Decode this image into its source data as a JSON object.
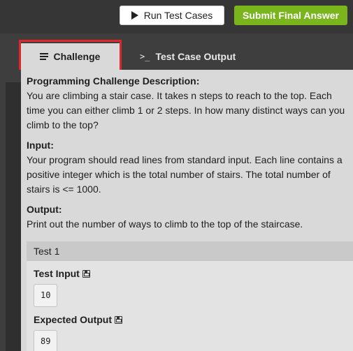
{
  "toolbar": {
    "run_label": "Run Test Cases",
    "submit_label": "Submit Final Answer"
  },
  "tabs": [
    {
      "label": "Challenge",
      "icon": "list-icon",
      "active": true
    },
    {
      "label": "Test Case Output",
      "icon": "terminal-icon",
      "active": false
    }
  ],
  "challenge": {
    "description_title": "Programming Challenge Description:",
    "description_text": "You are climbing a stair case. It takes n steps to reach to the top. Each time you can either climb 1 or 2 steps. In how many distinct ways can you climb to the top?",
    "input_title": "Input:",
    "input_text": "Your program should read lines from standard input. Each line contains a positive integer which is the total number of stairs. The total number of stairs is <= 1000.",
    "output_title": "Output:",
    "output_text": "Print out the number of ways to climb to the top of the staircase."
  },
  "test": {
    "header": "Test 1",
    "input_label": "Test Input",
    "input_value": "10",
    "expected_label": "Expected Output",
    "expected_value": "89"
  },
  "colors": {
    "submit": "#7ab51d",
    "highlight": "#e0262a",
    "panel": "#d9d9d9"
  }
}
